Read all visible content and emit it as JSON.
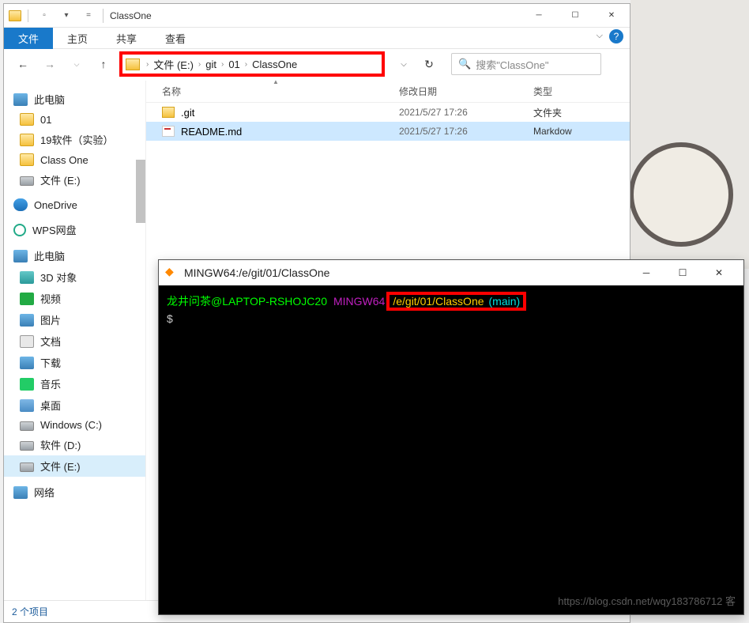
{
  "explorer": {
    "title": "ClassOne",
    "tabs": {
      "file": "文件",
      "home": "主页",
      "share": "共享",
      "view": "查看"
    },
    "breadcrumb": [
      "文件 (E:)",
      "git",
      "01",
      "ClassOne"
    ],
    "search_placeholder": "搜索\"ClassOne\"",
    "columns": {
      "name": "名称",
      "date": "修改日期",
      "type": "类型"
    },
    "rows": [
      {
        "name": ".git",
        "date": "2021/5/27 17:26",
        "type": "文件夹",
        "icon": "folder",
        "selected": false
      },
      {
        "name": "README.md",
        "date": "2021/5/27 17:26",
        "type": "Markdow",
        "icon": "md",
        "selected": true
      }
    ],
    "sidebar": [
      {
        "label": "此电脑",
        "ico": "pc",
        "lv": 1
      },
      {
        "label": "01",
        "ico": "folder",
        "lv": 2
      },
      {
        "label": "19软件（实验）",
        "ico": "folder",
        "lv": 2
      },
      {
        "label": "Class One",
        "ico": "folder",
        "lv": 2
      },
      {
        "label": "文件 (E:)",
        "ico": "drive",
        "lv": 2
      },
      {
        "label": "OneDrive",
        "ico": "onedrive",
        "lv": 1
      },
      {
        "label": "WPS网盘",
        "ico": "wps",
        "lv": 1
      },
      {
        "label": "此电脑",
        "ico": "pc",
        "lv": 1
      },
      {
        "label": "3D 对象",
        "ico": "obj3d",
        "lv": 2
      },
      {
        "label": "视频",
        "ico": "video",
        "lv": 2
      },
      {
        "label": "图片",
        "ico": "pic",
        "lv": 2
      },
      {
        "label": "文档",
        "ico": "doc",
        "lv": 2
      },
      {
        "label": "下载",
        "ico": "dl",
        "lv": 2
      },
      {
        "label": "音乐",
        "ico": "music",
        "lv": 2
      },
      {
        "label": "桌面",
        "ico": "desktop",
        "lv": 2
      },
      {
        "label": "Windows (C:)",
        "ico": "drive",
        "lv": 2
      },
      {
        "label": "软件 (D:)",
        "ico": "drive",
        "lv": 2
      },
      {
        "label": "文件 (E:)",
        "ico": "drive",
        "lv": 2,
        "hover": true
      },
      {
        "label": "网络",
        "ico": "net",
        "lv": 1
      }
    ],
    "status": "2 个项目"
  },
  "terminal": {
    "title": "MINGW64:/e/git/01/ClassOne",
    "user": "龙井问茶@LAPTOP-RSHOJC20",
    "shell": "MINGW64",
    "path": "/e/git/01/ClassOne",
    "branch": "(main)",
    "prompt": "$",
    "watermark": "https://blog.csdn.net/wqy183786712 客"
  }
}
